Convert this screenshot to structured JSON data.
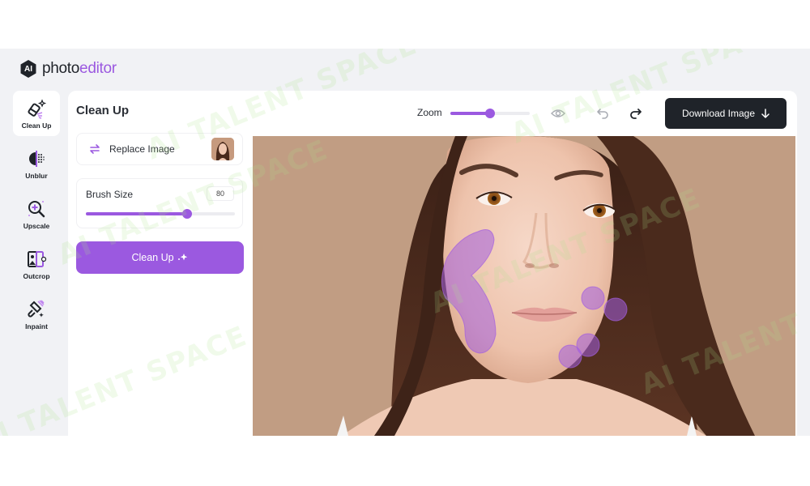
{
  "app": {
    "logo_badge": "AI",
    "logo_text_main": "photo",
    "logo_text_accent": "editor"
  },
  "sidebar": {
    "items": [
      {
        "label": "Clean Up",
        "icon": "eraser-sparkle-icon",
        "active": true
      },
      {
        "label": "Unblur",
        "icon": "unblur-icon",
        "active": false
      },
      {
        "label": "Upscale",
        "icon": "magnifier-plus-icon",
        "active": false
      },
      {
        "label": "Outcrop",
        "icon": "outcrop-icon",
        "active": false
      },
      {
        "label": "Inpaint",
        "icon": "paintbrush-icon",
        "active": false
      }
    ]
  },
  "panel": {
    "title": "Clean Up",
    "replace_label": "Replace Image",
    "brush_size_label": "Brush Size",
    "brush_size_value": "80",
    "brush_size_fraction": 0.68,
    "cleanup_button": "Clean Up"
  },
  "toolbar": {
    "zoom_label": "Zoom",
    "zoom_fraction": 0.5,
    "preview_icon": "eye-icon",
    "undo_icon": "undo-icon",
    "redo_icon": "redo-icon",
    "download_label": "Download Image"
  },
  "colors": {
    "accent": "#9b59e0",
    "dark": "#1f2329",
    "background": "#f1f2f5",
    "mask": "#a35ee0"
  },
  "watermark": "AI TALENT SPACE"
}
